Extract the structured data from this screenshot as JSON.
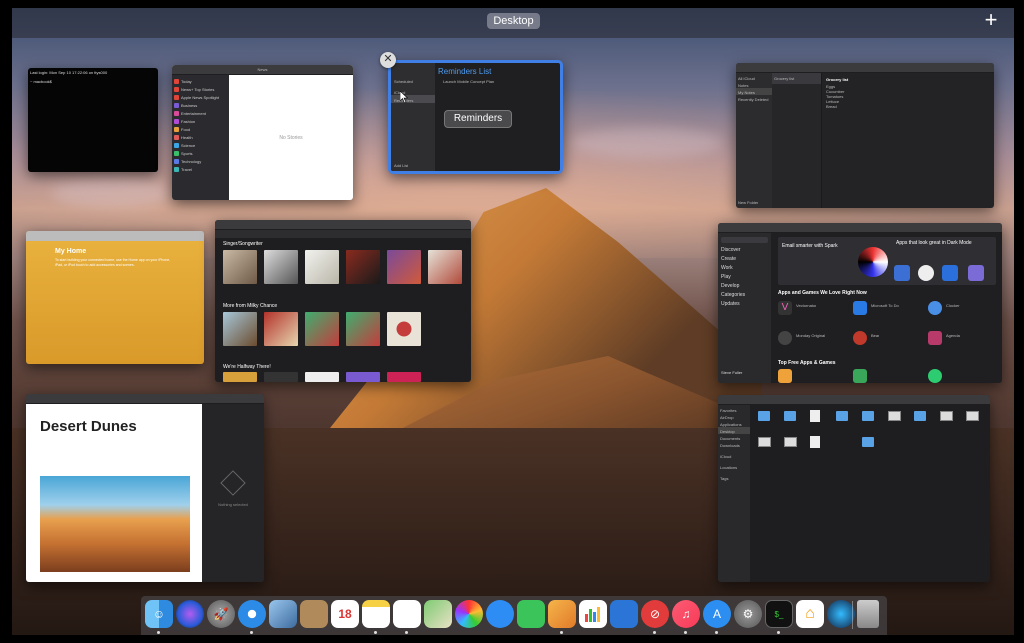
{
  "spaces": {
    "current": "Desktop",
    "add_label": "+"
  },
  "windows": {
    "terminal": {
      "line1": "Last login: Mon Sep 10 17:22:06 on ttys000",
      "line2": "~ macbook$"
    },
    "news": {
      "header": "News",
      "sidebar": [
        "Today",
        "News+ Top Stories",
        "Apple News Spotlight",
        "Business",
        "Entertainment",
        "Fashion",
        "Food",
        "Health",
        "Science",
        "Sports",
        "Technology",
        "Travel"
      ],
      "empty": "No Stories"
    },
    "reminders": {
      "list_title": "Reminders List",
      "item": "Launch Mobile Concept Plan",
      "sidebar": [
        "Scheduled",
        "iCloud",
        "Reminders"
      ],
      "label": "Reminders",
      "close_label": "✕",
      "footer": "Add List"
    },
    "notes": {
      "folders": [
        "All iCloud",
        "Notes",
        "My Notes",
        "Recently Deleted"
      ],
      "note_title": "Grocery list",
      "items": [
        "Eggs",
        "Cucumber",
        "Tomatoes",
        "Lettuce",
        "Bread"
      ],
      "footer": "New Folder"
    },
    "pages_flyer": {
      "title": "My Home",
      "body": "To start building your connected home, use the Home app on your iPhone, iPad, or iPod touch to add accessories and scenes."
    },
    "itunes": {
      "section1": "Singer/Songwriter",
      "section2": "More from Milky Chance",
      "section3": "We're Halfway There!"
    },
    "app_store": {
      "sidebar": [
        "Discover",
        "Create",
        "Work",
        "Play",
        "Develop",
        "Categories",
        "Updates"
      ],
      "banner": "Email smarter with Spark",
      "banner2": "Apps that look great in Dark Mode",
      "section1": "Apps and Games We Love Right Now",
      "section2": "Top Free Apps & Games",
      "apps": [
        "Vectornator",
        "Microsoft To Do",
        "Clocker",
        "Monday Original",
        "Bear",
        "Agenda"
      ],
      "user": "Steve Fuller"
    },
    "document": {
      "title": "Desert Dunes",
      "inspector_text": "Nothing selected"
    },
    "finder": {
      "sidebar": [
        "Favorites",
        "AirDrop",
        "Applications",
        "Desktop",
        "Documents",
        "Downloads",
        "iCloud",
        "Locations",
        "Tags"
      ]
    }
  },
  "dock": {
    "apps": [
      "Finder",
      "Siri",
      "Launchpad",
      "Safari",
      "Preview",
      "Contacts",
      "Calendar",
      "Notes",
      "Reminders",
      "Maps",
      "Photos",
      "Messages",
      "FaceTime",
      "Pages",
      "Numbers",
      "Keynote",
      "News",
      "Music",
      "App Store",
      "System Preferences",
      "Terminal",
      "Home",
      "Screen Saver"
    ],
    "calendar_day": "18",
    "trash": "Trash"
  }
}
